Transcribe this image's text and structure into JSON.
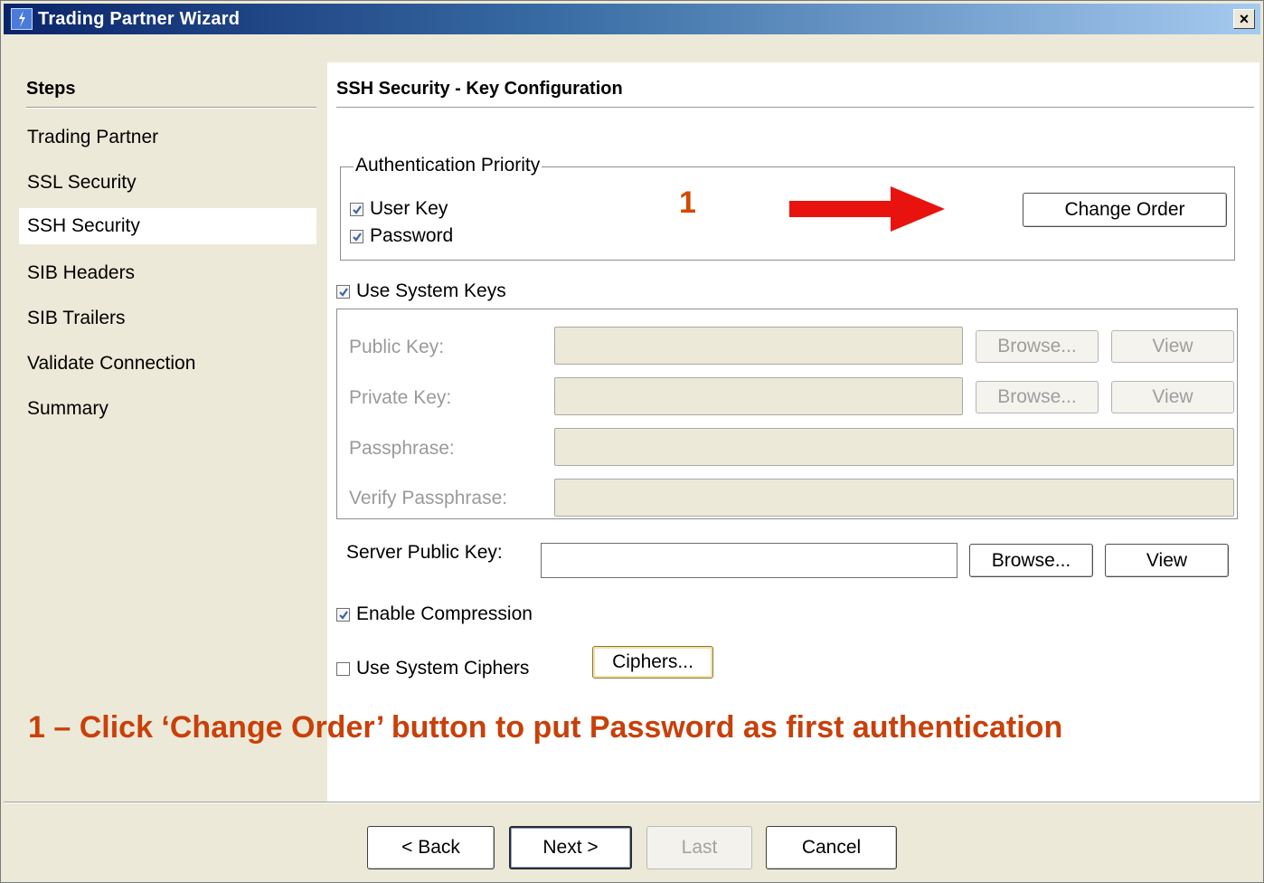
{
  "window": {
    "title": "Trading Partner Wizard",
    "close_label": "×"
  },
  "steps": {
    "title": "Steps",
    "items": [
      {
        "label": "Trading Partner"
      },
      {
        "label": "SSL Security"
      },
      {
        "label": "SSH Security",
        "active": true
      },
      {
        "label": "SIB Headers"
      },
      {
        "label": "SIB Trailers"
      },
      {
        "label": "Validate Connection"
      },
      {
        "label": "Summary"
      }
    ]
  },
  "main": {
    "title": "SSH Security - Key Configuration",
    "auth_priority": {
      "legend": "Authentication Priority",
      "items": [
        {
          "label": "User Key",
          "checked": true
        },
        {
          "label": "Password",
          "checked": true
        }
      ],
      "change_order_label": "Change Order"
    },
    "use_system_keys": {
      "label": "Use System Keys",
      "checked": true
    },
    "keys": {
      "public_key_label": "Public Key:",
      "private_key_label": "Private Key:",
      "passphrase_label": "Passphrase:",
      "verify_passphrase_label": "Verify Passphrase:",
      "browse_label": "Browse...",
      "view_label": "View"
    },
    "server_public_key": {
      "label": "Server Public Key:",
      "value": "",
      "browse_label": "Browse...",
      "view_label": "View"
    },
    "enable_compression": {
      "label": "Enable Compression",
      "checked": true
    },
    "use_system_ciphers": {
      "label": "Use System Ciphers",
      "checked": false
    },
    "ciphers_label": "Ciphers..."
  },
  "annotation": {
    "number": "1",
    "text": "1 – Click ‘Change Order’ button to put Password as first authentication",
    "color": "#c8400a"
  },
  "footer": {
    "back_label": "< Back",
    "next_label": "Next >",
    "last_label": "Last",
    "cancel_label": "Cancel"
  },
  "colors": {
    "titlebar_start": "#0a246a",
    "titlebar_end": "#a6caf0",
    "dialog_bg": "#ece9d8",
    "arrow": "#e8130f"
  }
}
